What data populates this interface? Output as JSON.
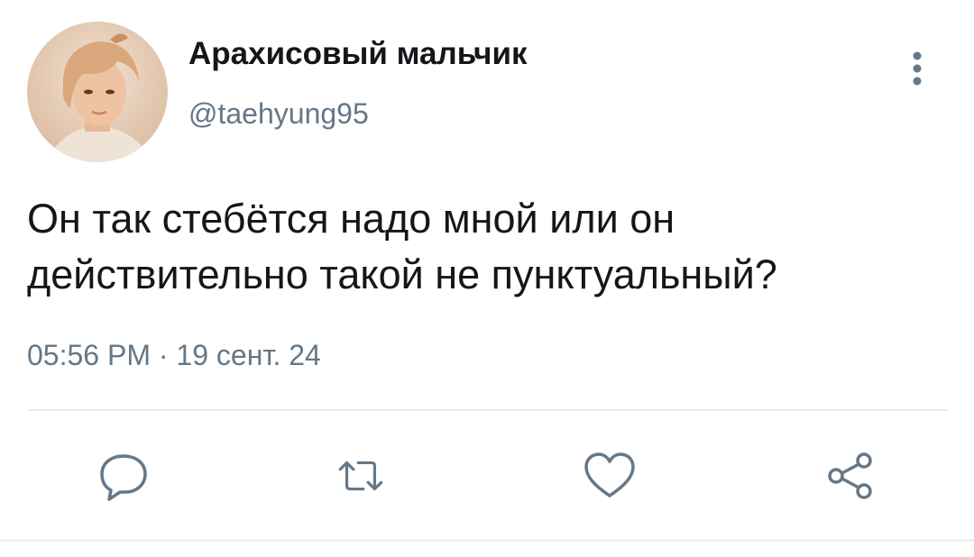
{
  "tweet": {
    "display_name": "Арахисовый мальчик",
    "handle": "@taehyung95",
    "text": "Он так стебётся надо мной или он\nдействительно такой не пунктуальный?",
    "timestamp": "05:56 PM · 19 сент. 24"
  },
  "actions": {
    "reply_icon": "reply-icon",
    "retweet_icon": "retweet-icon",
    "like_icon": "heart-icon",
    "share_icon": "share-icon",
    "more_icon": "more-vertical-icon"
  },
  "colors": {
    "text": "#14171a",
    "secondary": "#657786",
    "icon": "#667888",
    "divider": "#e6ecf0"
  }
}
